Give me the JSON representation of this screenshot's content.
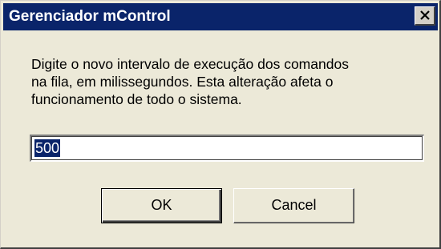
{
  "window": {
    "title": "Gerenciador mControl"
  },
  "dialog": {
    "message_lines": [
      "Digite o novo intervalo de execução dos comandos",
      "na fila, em milissegundos. Esta alteração afeta o",
      "funcionamento de todo o sistema."
    ],
    "input_value": "500",
    "ok_label": "OK",
    "cancel_label": "Cancel"
  },
  "icons": {
    "close": "close-icon"
  },
  "colors": {
    "titlebar": "#0a246a",
    "dialog_background": "#ece9d8",
    "selection": "#0a246a"
  }
}
